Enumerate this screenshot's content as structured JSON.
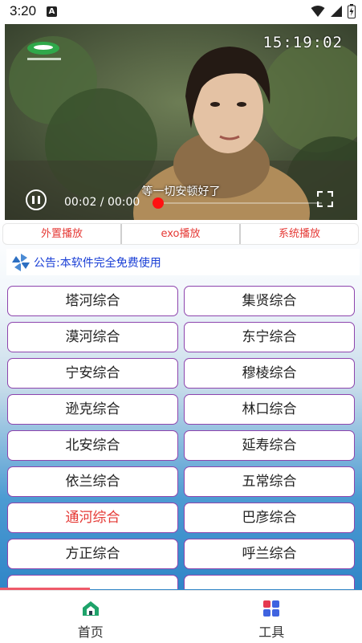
{
  "status_bar": {
    "time": "3:20",
    "a_badge": "A"
  },
  "video": {
    "clock": "15:19:02",
    "subtitle": "等一切安顿好了",
    "timecode": "00:02 / 00:00",
    "progress": 0.0
  },
  "player_tabs": [
    {
      "label": "外置播放"
    },
    {
      "label": "exo播放"
    },
    {
      "label": "系统播放"
    }
  ],
  "notice": {
    "text": "公告:本软件完全免费使用"
  },
  "channels": [
    {
      "label": "塔河综合",
      "active": false
    },
    {
      "label": "集贤综合",
      "active": false
    },
    {
      "label": "漠河综合",
      "active": false
    },
    {
      "label": "东宁综合",
      "active": false
    },
    {
      "label": "宁安综合",
      "active": false
    },
    {
      "label": "穆棱综合",
      "active": false
    },
    {
      "label": "逊克综合",
      "active": false
    },
    {
      "label": "林口综合",
      "active": false
    },
    {
      "label": "北安综合",
      "active": false
    },
    {
      "label": "延寿综合",
      "active": false
    },
    {
      "label": "依兰综合",
      "active": false
    },
    {
      "label": "五常综合",
      "active": false
    },
    {
      "label": "通河综合",
      "active": true
    },
    {
      "label": "巴彦综合",
      "active": false
    },
    {
      "label": "方正综合",
      "active": false
    },
    {
      "label": "呼兰综合",
      "active": false
    },
    {
      "label": "",
      "active": false
    },
    {
      "label": "",
      "active": false
    }
  ],
  "bottom_nav": [
    {
      "label": "首页",
      "icon": "home-icon"
    },
    {
      "label": "工具",
      "icon": "tools-icon"
    }
  ],
  "colors": {
    "accent_red": "#e53935",
    "notice_blue": "#1a3fd6",
    "button_border": "#8e44ad"
  }
}
